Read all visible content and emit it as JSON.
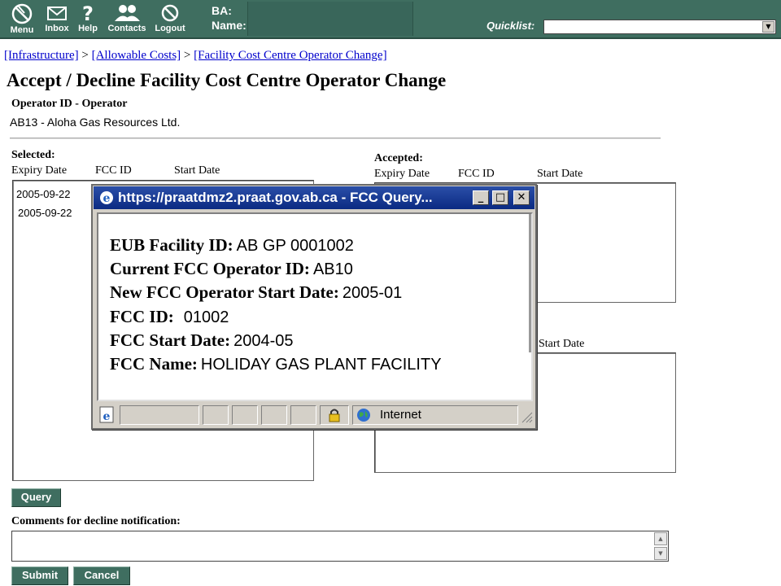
{
  "nav": {
    "items": [
      {
        "label": "Menu",
        "icon": "menu-icon"
      },
      {
        "label": "Inbox",
        "icon": "envelope-icon"
      },
      {
        "label": "Help",
        "icon": "question-icon"
      },
      {
        "label": "Contacts",
        "icon": "people-icon"
      },
      {
        "label": "Logout",
        "icon": "logout-icon"
      }
    ],
    "ba_label": "BA:",
    "name_label": "Name:",
    "quicklist_label": "Quicklist:",
    "quicklist_value": ""
  },
  "breadcrumb": [
    "[Infrastructure]",
    "[Allowable Costs]",
    "[Facility Cost Centre Operator Change]"
  ],
  "breadcrumb_sep": ">",
  "title": "Accept / Decline Facility Cost Centre Operator Change",
  "operator": {
    "label": "Operator ID - Operator",
    "value": "AB13 - Aloha Gas Resources Ltd."
  },
  "selected": {
    "label": "Selected:",
    "columns": [
      "Expiry Date",
      "FCC ID",
      "Start Date"
    ],
    "rows": [
      "2005-09-22",
      "2005-09-22"
    ]
  },
  "accepted": {
    "label": "Accepted:",
    "columns": [
      "Expiry Date",
      "FCC ID",
      "Start Date"
    ]
  },
  "second_list": {
    "visible_column": "Start Date"
  },
  "buttons": {
    "query": "Query",
    "submit": "Submit",
    "cancel": "Cancel"
  },
  "comments": {
    "label": "Comments for decline notification:",
    "value": ""
  },
  "popup": {
    "title": "https://praatdmz2.praat.gov.ab.ca - FCC Query...",
    "fields": [
      {
        "label": "EUB Facility ID:",
        "value": "AB GP 0001002"
      },
      {
        "label": "Current FCC Operator ID:",
        "value": "AB10"
      },
      {
        "label": "New FCC Operator Start Date:",
        "value": "2005-01"
      },
      {
        "label": "FCC ID:",
        "value": "01002"
      },
      {
        "label": "FCC Start Date:",
        "value": "2004-05"
      },
      {
        "label": "FCC Name:",
        "value": "HOLIDAY GAS PLANT FACILITY"
      }
    ],
    "status_zone": "Internet"
  },
  "colors": {
    "nav_bg": "#3f6e60",
    "link": "#0000cc",
    "popup_title_bg": "#0a2a82"
  }
}
